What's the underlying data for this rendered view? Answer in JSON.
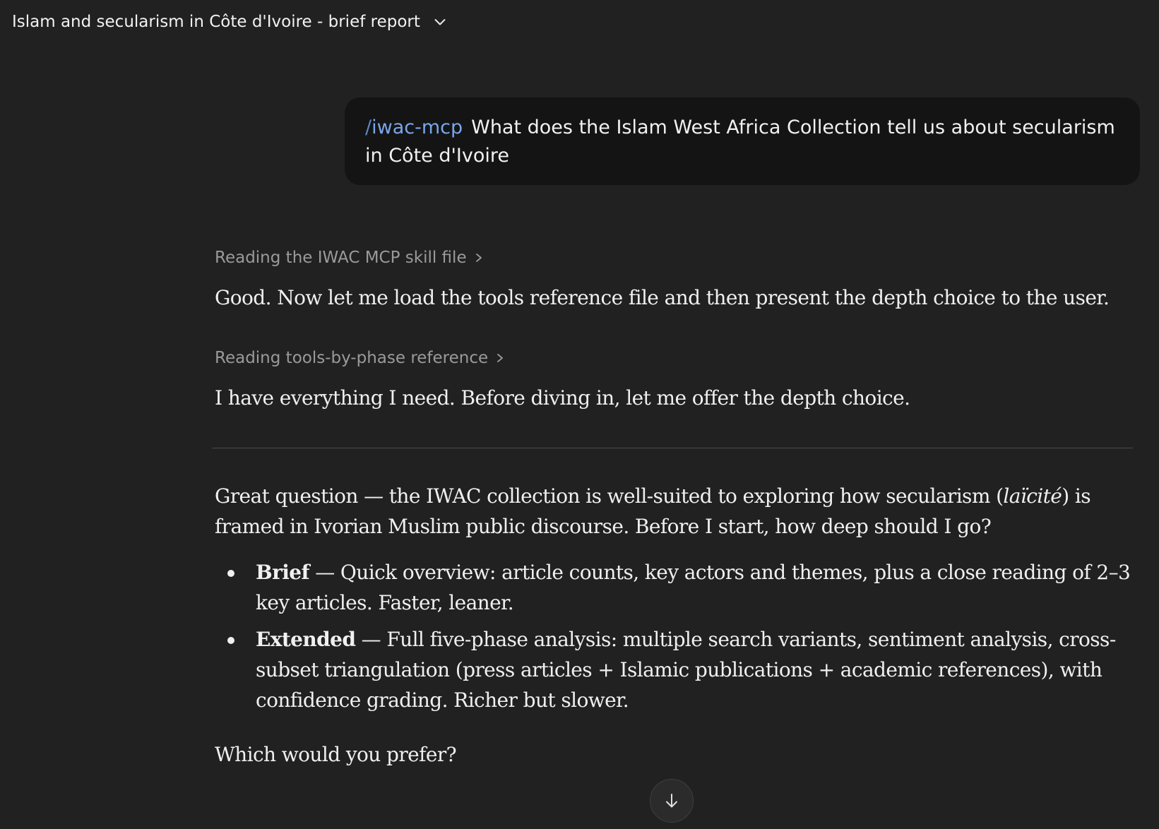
{
  "header": {
    "title": "Islam and secularism in Côte d'Ivoire - brief report",
    "menu_icon": "chevron-down-icon"
  },
  "user_message": {
    "command_slash": "/",
    "command_name": "iwac-mcp",
    "text": "What does the Islam West Africa Collection tell us about secularism in Côte d'Ivoire"
  },
  "assistant": {
    "steps": [
      {
        "label": "Reading the IWAC MCP skill file",
        "icon": "chevron-right-icon",
        "text": "Good. Now let me load the tools reference file and then present the depth choice to the user."
      },
      {
        "label": "Reading tools-by-phase reference",
        "icon": "chevron-right-icon",
        "text": "I have everything I need. Before diving in, let me offer the depth choice."
      }
    ],
    "response": {
      "intro_before": "Great question — the IWAC collection is well-suited to exploring how secularism (",
      "intro_emphasis": "laïcité",
      "intro_after": ") is framed in Ivorian Muslim public discourse. Before I start, how deep should I go?",
      "options": [
        {
          "name": "Brief",
          "description": " — Quick overview: article counts, key actors and themes, plus a close reading of 2–3 key articles. Faster, leaner."
        },
        {
          "name": "Extended",
          "description": " — Full five-phase analysis: multiple search variants, sentiment analysis, cross-subset triangulation (press articles + Islamic publications + academic references), with confidence grading. Richer but slower."
        }
      ],
      "question": "Which would you prefer?"
    }
  },
  "scroll_button": {
    "icon": "arrow-down-icon"
  },
  "colors": {
    "background": "#212121",
    "user_bubble": "#141414",
    "command_accent": "#7aa6ea",
    "step_text": "#9a9a9a"
  }
}
